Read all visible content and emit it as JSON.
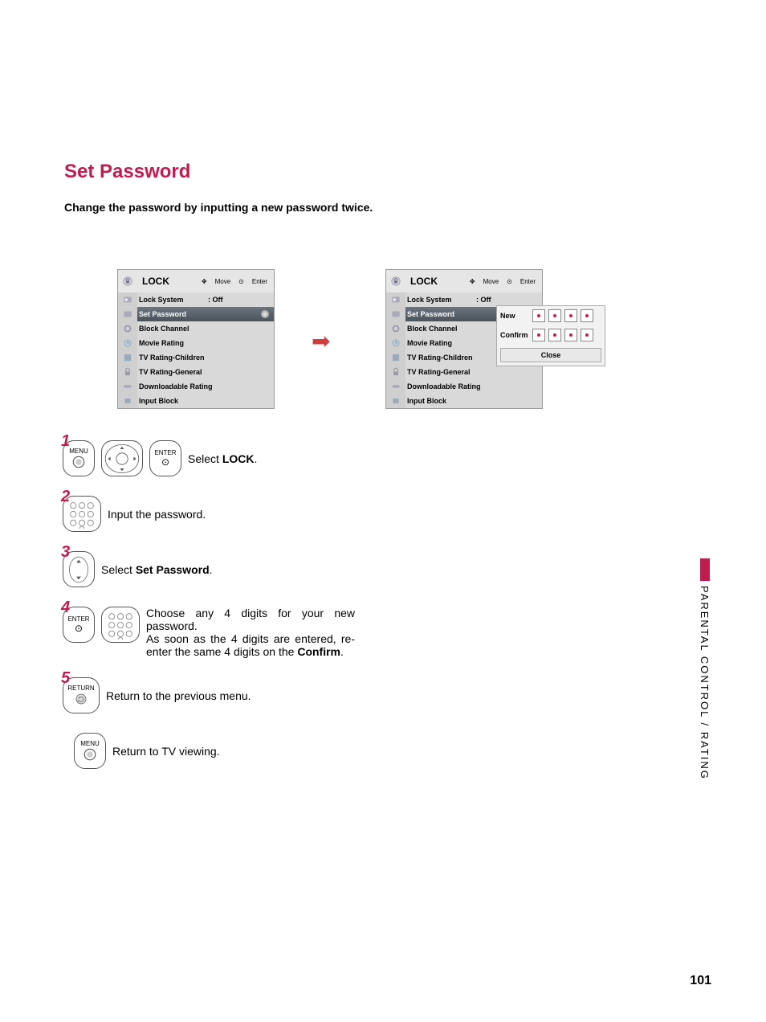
{
  "page": {
    "title": "Set Password",
    "subtitle": "Change the password by inputting a new password twice.",
    "number": "101"
  },
  "side_tab": "PARENTAL CONTROL / RATING",
  "menu": {
    "title": "LOCK",
    "hint_move": "Move",
    "hint_enter": "Enter",
    "items": [
      {
        "label": "Lock System",
        "value": ": Off"
      },
      {
        "label": "Set Password",
        "value": ""
      },
      {
        "label": "Block Channel",
        "value": ""
      },
      {
        "label": "Movie Rating",
        "value": ""
      },
      {
        "label": "TV Rating-Children",
        "value": ""
      },
      {
        "label": "TV Rating-General",
        "value": ""
      },
      {
        "label": "Downloadable Rating",
        "value": ""
      },
      {
        "label": "Input Block",
        "value": ""
      }
    ],
    "selected_index": 1
  },
  "popup": {
    "new_label": "New",
    "confirm_label": "Confirm",
    "close_label": "Close"
  },
  "steps": {
    "s1": {
      "num": "1",
      "btn_menu": "MENU",
      "btn_enter": "ENTER",
      "text_prefix": "Select ",
      "text_bold": "LOCK",
      "text_suffix": "."
    },
    "s2": {
      "num": "2",
      "text": "Input the password."
    },
    "s3": {
      "num": "3",
      "text_prefix": "Select ",
      "text_bold": "Set Password",
      "text_suffix": "."
    },
    "s4": {
      "num": "4",
      "btn_enter": "ENTER",
      "line1": "Choose any 4 digits for your new password.",
      "line2_a": "As soon as the 4 digits are entered, re-enter the same 4 digits on the ",
      "line2_b": "Confirm",
      "line2_c": "."
    },
    "s5": {
      "num": "5",
      "btn_return": "RETURN",
      "text": "Return to the previous menu."
    },
    "s6": {
      "btn_menu": "MENU",
      "text": "Return to TV viewing."
    }
  }
}
